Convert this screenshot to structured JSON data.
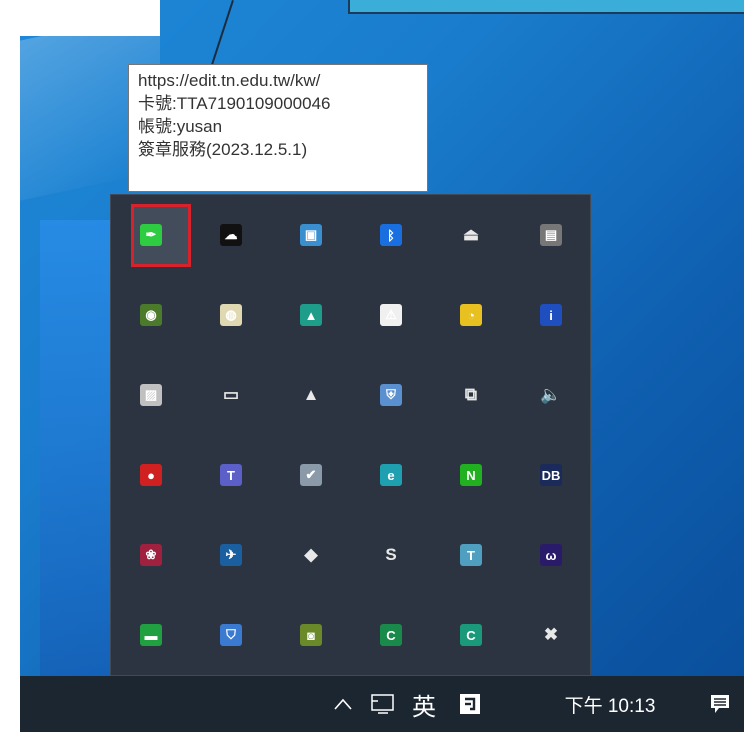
{
  "tooltip": {
    "line1": "https://edit.tn.edu.tw/kw/",
    "line2": "卡號:TTA7190109000046",
    "line3": "帳號:yusan",
    "line4": "簽章服務(2023.12.5.1)"
  },
  "taskbar": {
    "show_hidden_icons": "^",
    "ime_label": "英",
    "clock": "下午 10:13"
  },
  "tray_icons": [
    [
      {
        "name": "signature-service-icon",
        "glyph": "✒",
        "color": "#2ecc40",
        "selected": true
      },
      {
        "name": "cloud-sync-icon",
        "glyph": "☁",
        "color": "#111111"
      },
      {
        "name": "network-monitor-icon",
        "glyph": "▣",
        "color": "#3a8fd0"
      },
      {
        "name": "bluetooth-icon",
        "glyph": "ᛒ",
        "color": "#1a6fe0"
      },
      {
        "name": "usb-eject-icon",
        "glyph": "⏏",
        "color": "transparent"
      },
      {
        "name": "storage-icon",
        "glyph": "▤",
        "color": "#777777"
      }
    ],
    [
      {
        "name": "nvidia-icon",
        "glyph": "◉",
        "color": "#4a7a2a"
      },
      {
        "name": "disk-utility-icon",
        "glyph": "◍",
        "color": "#e0d8b0"
      },
      {
        "name": "mountain-app-icon",
        "glyph": "▲",
        "color": "#1e9e8a"
      },
      {
        "name": "security-warning-icon",
        "glyph": "⚠",
        "color": "#f0f0f0"
      },
      {
        "name": "locked-clock-icon",
        "glyph": "◔",
        "color": "#e8c020"
      },
      {
        "name": "info-icon",
        "glyph": "i",
        "color": "#1f4fbf"
      }
    ],
    [
      {
        "name": "photo-tool-icon",
        "glyph": "▨",
        "color": "#c0c0c0"
      },
      {
        "name": "battery-icon",
        "glyph": "▭",
        "color": "transparent"
      },
      {
        "name": "red-green-logo-icon",
        "glyph": "▲",
        "color": "transparent"
      },
      {
        "name": "shield-icon",
        "glyph": "⛨",
        "color": "#5a8fd0"
      },
      {
        "name": "meet-now-icon",
        "glyph": "⧉",
        "color": "transparent"
      },
      {
        "name": "speaker-icon",
        "glyph": "🔈",
        "color": "transparent"
      }
    ],
    [
      {
        "name": "red-ball-app-icon",
        "glyph": "●",
        "color": "#d02020"
      },
      {
        "name": "teams-icon",
        "glyph": "T",
        "color": "#5b5fc7"
      },
      {
        "name": "check-app-icon",
        "glyph": "✔",
        "color": "#8a9aa8"
      },
      {
        "name": "eset-icon",
        "glyph": "e",
        "color": "#1fa0b0"
      },
      {
        "name": "line-messenger-icon",
        "glyph": "N",
        "color": "#20b020"
      },
      {
        "name": "db-app-icon",
        "glyph": "DB",
        "color": "#1a2a5a"
      }
    ],
    [
      {
        "name": "emblem-app-icon",
        "glyph": "❀",
        "color": "#a02040"
      },
      {
        "name": "satellite-app-icon",
        "glyph": "✈",
        "color": "#1a5fa0"
      },
      {
        "name": "dropbox-icon",
        "glyph": "◆",
        "color": "transparent"
      },
      {
        "name": "synergy-icon",
        "glyph": "S",
        "color": "transparent"
      },
      {
        "name": "tsss-app-icon",
        "glyph": "T",
        "color": "#4fa0c0"
      },
      {
        "name": "webex-icon",
        "glyph": "ω",
        "color": "#2a1a6a"
      }
    ],
    [
      {
        "name": "green-window-icon",
        "glyph": "▬",
        "color": "#20a040"
      },
      {
        "name": "shield-lock-icon",
        "glyph": "⛉",
        "color": "#3a7ad0"
      },
      {
        "name": "green-screen-icon",
        "glyph": "◙",
        "color": "#6a8a2a"
      },
      {
        "name": "green-c-icon",
        "glyph": "C",
        "color": "#1a8a4a"
      },
      {
        "name": "green-c2-icon",
        "glyph": "C",
        "color": "#1a9a7a"
      },
      {
        "name": "usb-stop-icon",
        "glyph": "✖",
        "color": "transparent"
      }
    ]
  ]
}
